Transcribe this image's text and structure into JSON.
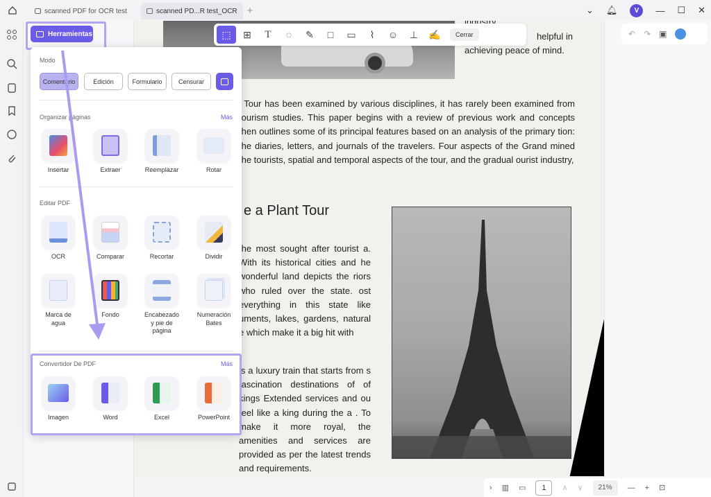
{
  "tabs": [
    {
      "label": "scanned PDF for OCR test",
      "active": false
    },
    {
      "label": "scanned PD...R test_OCR",
      "active": true
    }
  ],
  "user_initial": "V",
  "toolbar": {
    "close_label": "Cerrar"
  },
  "herramientas": {
    "label": "Herramientas"
  },
  "popup": {
    "mode_title": "Modo",
    "modes": [
      "Comentario",
      "Edición",
      "Formulario",
      "Censurar"
    ],
    "organize_title": "Organizar páginas",
    "organize_more": "Más",
    "organize": [
      "Insertar",
      "Extraer",
      "Reemplazar",
      "Rotar"
    ],
    "edit_title": "Editar PDF",
    "edit_row1": [
      "OCR",
      "Comparar",
      "Recortar",
      "Dividir"
    ],
    "edit_row2": [
      "Marca de agua",
      "Fondo",
      "Encabezado y pie de página",
      "Numeración Bates"
    ],
    "convert_title": "Convertidor De PDF",
    "convert_more": "Más",
    "convert": [
      "Imagen",
      "Word",
      "Excel",
      "PowerPoint"
    ]
  },
  "document": {
    "top_right_lines": [
      "industry",
      "helpful in",
      "achieving peace of mind."
    ],
    "para1": "l Tour has been examined by various disciplines, it has rarely been examined from tourism studies. This paper begins with a review of previous work and concepts then outlines some of its principal features based on an analysis of the primary tion: the diaries, letters, and journals of the travelers. Four aspects of the Grand mined the tourists, spatial and temporal aspects of the tour, and the gradual ourist industry,",
    "heading": "e a Plant Tour",
    "para2": "the most sought after tourist a. With its historical cities and he wonderful land depicts the riors who ruled over the state. ost everything in this state like uments, lakes, gardens, natural e which make it a big hit with",
    "para3": "is a luxury train that starts from s fascination destinations of of kings Extended services and ou feel like a king during the a . To make it more royal, the amenities and services are provided as per the latest trends and requirements."
  },
  "bottom": {
    "page": "1",
    "zoom": "21%"
  },
  "colors": {
    "accent": "#6b5ce7",
    "highlight": "#b3a5f2"
  }
}
